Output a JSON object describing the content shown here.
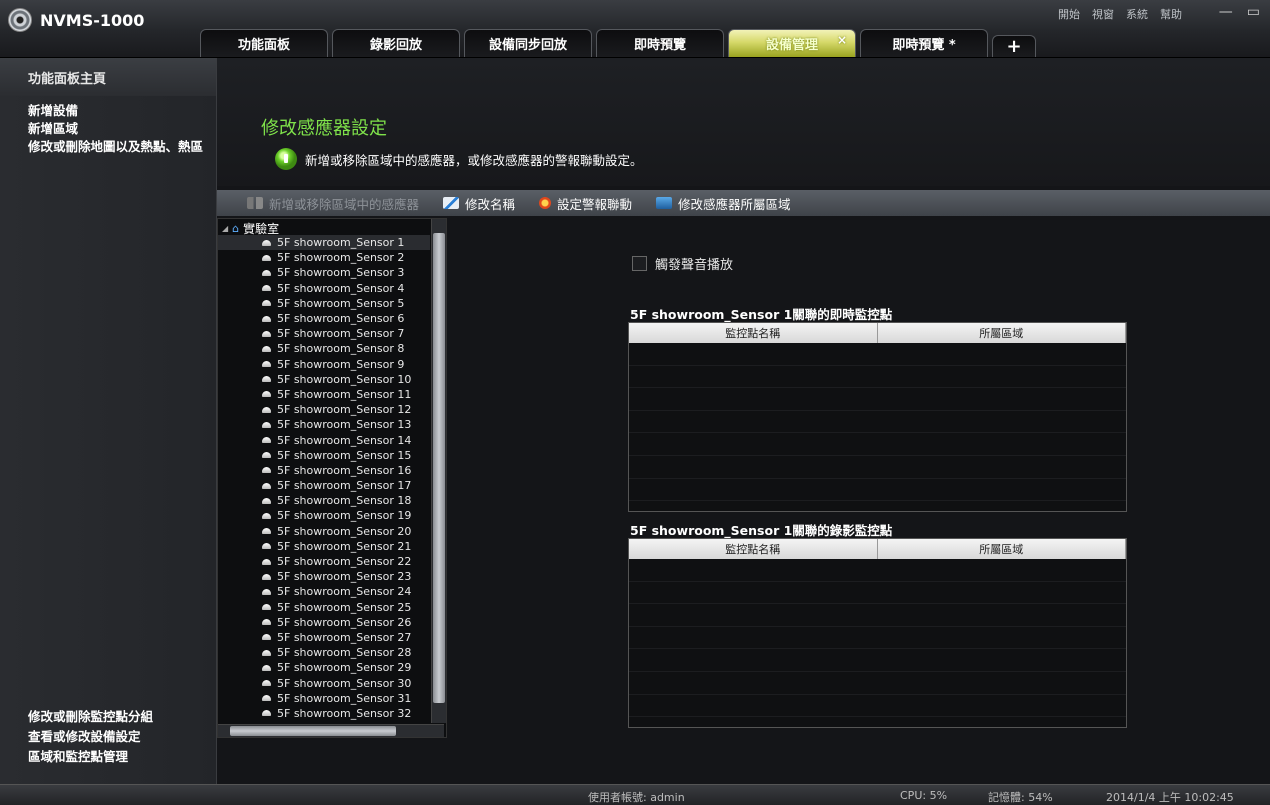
{
  "app": {
    "title": "NVMS-1000"
  },
  "top_menu": [
    "開始",
    "視窗",
    "系統",
    "幫助"
  ],
  "window_controls": {
    "minimize": "—",
    "restore": "▭"
  },
  "tabs": [
    {
      "label": "功能面板"
    },
    {
      "label": "錄影回放"
    },
    {
      "label": "設備同步回放"
    },
    {
      "label": "即時預覽"
    },
    {
      "label": "設備管理",
      "active": true,
      "close": "×"
    },
    {
      "label": "即時預覽 *"
    },
    {
      "label": "+"
    }
  ],
  "sidebar": {
    "home": "功能面板主頁",
    "top_items": [
      "新增設備",
      "新增區域",
      "修改或刪除地圖以及熱點、熱區"
    ],
    "bottom_items": [
      "修改或刪除監控點分組",
      "查看或修改設備設定",
      "區域和監控點管理"
    ]
  },
  "main": {
    "title": "修改感應器設定",
    "description": "新增或移除區域中的感應器，或修改感應器的警報聯動設定。"
  },
  "toolbar": {
    "add_remove": "新增或移除區域中的感應器",
    "rename": "修改名稱",
    "alarm_link": "設定警報聯動",
    "change_area": "修改感應器所屬區域"
  },
  "tree": {
    "root": "實驗室",
    "items": [
      "5F showroom_Sensor 1",
      "5F showroom_Sensor 2",
      "5F showroom_Sensor 3",
      "5F showroom_Sensor 4",
      "5F showroom_Sensor 5",
      "5F showroom_Sensor 6",
      "5F showroom_Sensor 7",
      "5F showroom_Sensor 8",
      "5F showroom_Sensor 9",
      "5F showroom_Sensor 10",
      "5F showroom_Sensor 11",
      "5F showroom_Sensor 12",
      "5F showroom_Sensor 13",
      "5F showroom_Sensor 14",
      "5F showroom_Sensor 15",
      "5F showroom_Sensor 16",
      "5F showroom_Sensor 17",
      "5F showroom_Sensor 18",
      "5F showroom_Sensor 19",
      "5F showroom_Sensor 20",
      "5F showroom_Sensor 21",
      "5F showroom_Sensor 22",
      "5F showroom_Sensor 23",
      "5F showroom_Sensor 24",
      "5F showroom_Sensor 25",
      "5F showroom_Sensor 26",
      "5F showroom_Sensor 27",
      "5F showroom_Sensor 28",
      "5F showroom_Sensor 29",
      "5F showroom_Sensor 30",
      "5F showroom_Sensor 31",
      "5F showroom_Sensor 32"
    ],
    "selected_index": 0
  },
  "sound": {
    "label": "觸發聲音播放",
    "checked": false
  },
  "live_section": {
    "title": "5F showroom_Sensor 1關聯的即時監控點",
    "columns": [
      "監控點名稱",
      "所屬區域"
    ],
    "rows": []
  },
  "record_section": {
    "title": "5F showroom_Sensor 1關聯的錄影監控點",
    "columns": [
      "監控點名稱",
      "所屬區域"
    ],
    "rows": []
  },
  "status": {
    "user": "使用者帳號: admin",
    "cpu": "CPU: 5%",
    "memory": "記憶體: 54%",
    "datetime": "2014/1/4 上午 10:02:45"
  },
  "colors": {
    "title_green": "#7fe24a",
    "active_tab": "#c8cf50"
  }
}
